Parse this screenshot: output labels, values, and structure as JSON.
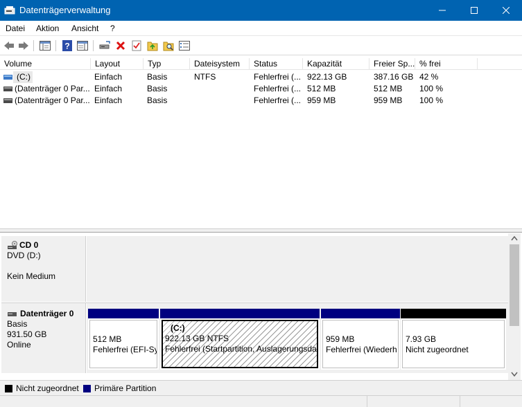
{
  "window": {
    "title": "Datenträgerverwaltung",
    "accent": "#0063b1"
  },
  "menu": [
    "Datei",
    "Aktion",
    "Ansicht",
    "?"
  ],
  "toolbar_icons": [
    "back-arrow-icon",
    "forward-arrow-icon",
    "console-tree-icon",
    "help-icon",
    "properties-panel-icon",
    "connect-drive-icon",
    "delete-icon",
    "check-icon",
    "import-icon",
    "search-icon",
    "settings-list-icon"
  ],
  "volumes": {
    "columns": [
      "Volume",
      "Layout",
      "Typ",
      "Dateisystem",
      "Status",
      "Kapazität",
      "Freier Sp...",
      "% frei"
    ],
    "rows": [
      [
        "(C:)",
        "Einfach",
        "Basis",
        "NTFS",
        "Fehlerfrei (...",
        "922.13 GB",
        "387.16 GB",
        "42 %"
      ],
      [
        "(Datenträger 0 Par...",
        "Einfach",
        "Basis",
        "",
        "Fehlerfrei (...",
        "512 MB",
        "512 MB",
        "100 %"
      ],
      [
        "(Datenträger 0 Par...",
        "Einfach",
        "Basis",
        "",
        "Fehlerfrei (...",
        "959 MB",
        "959 MB",
        "100 %"
      ]
    ]
  },
  "disks": {
    "cd": {
      "name": "CD 0",
      "line1": "DVD (D:)",
      "line2": "Kein Medium"
    },
    "disk0": {
      "name": "Datenträger 0",
      "type": "Basis",
      "size": "931.50 GB",
      "state": "Online",
      "partitions": [
        {
          "title": "",
          "size": "512 MB",
          "status": "Fehlerfrei (EFI-Sy",
          "color": "#000080"
        },
        {
          "title": "(C:)",
          "size": "922.13 GB NTFS",
          "status": "Fehlerfrei (Startpartition, Auslagerungsda",
          "color": "#000080"
        },
        {
          "title": "",
          "size": "959 MB",
          "status": "Fehlerfrei (Wiederh",
          "color": "#000080"
        },
        {
          "title": "",
          "size": "7.93 GB",
          "status": "Nicht zugeordnet",
          "color": "#000000"
        }
      ]
    }
  },
  "legend": {
    "unallocated": "Nicht zugeordnet",
    "primary": "Primäre Partition",
    "unallocated_color": "#000000",
    "primary_color": "#000080"
  }
}
